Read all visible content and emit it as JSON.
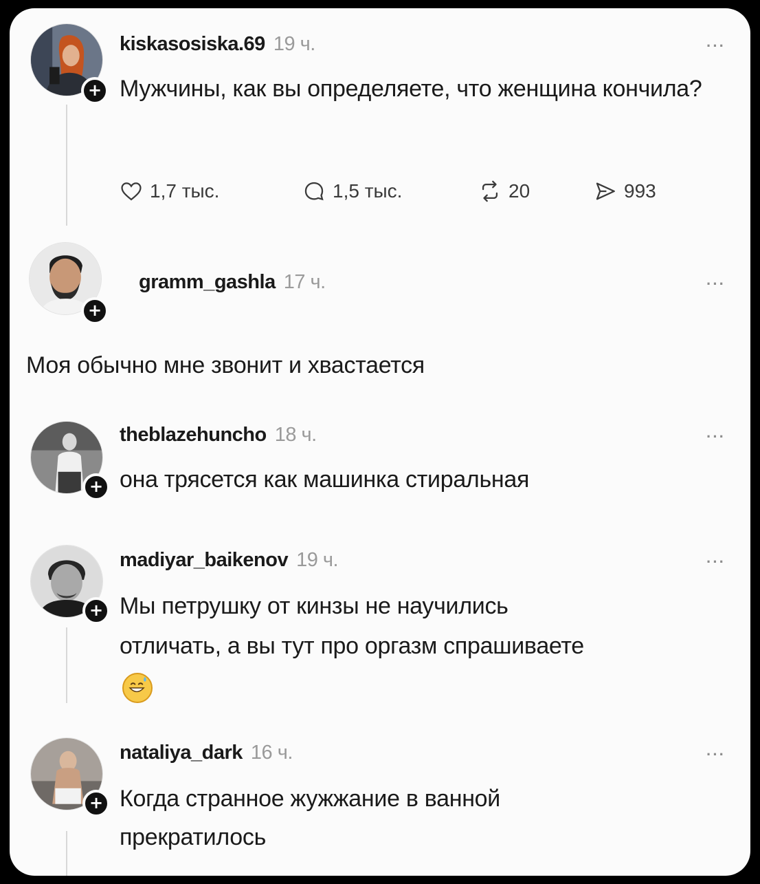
{
  "post": {
    "username": "kiskasosiska.69",
    "time": "19 ч.",
    "more": "···",
    "text": "Мужчины, как вы определяете, что женщина кончила?",
    "actions": {
      "likes": "1,7 тыс.",
      "comments": "1,5 тыс.",
      "reposts": "20",
      "shares": "993"
    },
    "icons": [
      "heart-icon",
      "comment-icon",
      "repost-icon",
      "share-icon"
    ]
  },
  "replies": [
    {
      "username": "gramm_gashla",
      "time": "17 ч.",
      "more": "···",
      "text": "Моя обычно мне звонит и хвастается"
    },
    {
      "username": "theblazehuncho",
      "time": "18 ч.",
      "more": "···",
      "text": "она трясется как машинка стиральная"
    },
    {
      "username": "madiyar_baikenov",
      "time": "19 ч.",
      "more": "···",
      "text_line1": "Мы петрушку от кинзы не научились",
      "text_line2": "отличать, а вы тут про оргазм спрашиваете",
      "emoji": "grinning-face-with-sweat"
    },
    {
      "username": "nataliya_dark",
      "time": "16 ч.",
      "more": "···",
      "text_line1": "Когда странное жужжание в ванной",
      "text_line2": "прекратилось"
    }
  ],
  "follow_badge": "+",
  "colors": {
    "background": "#fbfbfb",
    "frame": "#000000",
    "text": "#1a1a1a",
    "muted": "#9a9a9a"
  }
}
